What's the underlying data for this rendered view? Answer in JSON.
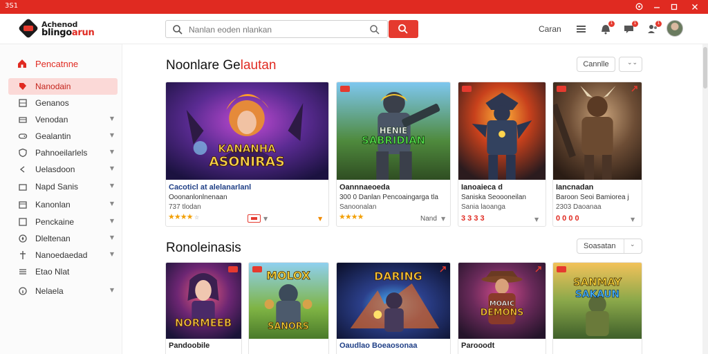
{
  "window": {
    "app_mark": "3S1",
    "controls": [
      "settings",
      "minimize",
      "maximize",
      "close"
    ]
  },
  "header": {
    "logo_line1": "Achenod",
    "logo_line2_a": "blingo",
    "logo_line2_b": "arun",
    "search_placeholder": "Nanlan eoden nlankan",
    "right_label": "Caran",
    "icons": [
      "menu-icon",
      "bell-icon",
      "chat-icon",
      "friends-icon"
    ],
    "badge_count": "1"
  },
  "sidebar": {
    "home_label": "Pencatnne",
    "items": [
      {
        "label": "Nanodain",
        "icon": "tag-icon",
        "has_chevron": false,
        "active": true
      },
      {
        "label": "Genanos",
        "icon": "grid-icon",
        "has_chevron": false
      },
      {
        "label": "Venodan",
        "icon": "tray-icon",
        "has_chevron": true
      },
      {
        "label": "Gealantin",
        "icon": "gamepad-icon",
        "has_chevron": true
      },
      {
        "label": "Pahnoeilarlels",
        "icon": "shield-icon",
        "has_chevron": true
      },
      {
        "label": "Uelasdoon",
        "icon": "chevron-left-icon",
        "has_chevron": true
      },
      {
        "label": "Napd Sanis",
        "icon": "store-icon",
        "has_chevron": true
      },
      {
        "label": "Kanonlan",
        "icon": "calendar-icon",
        "has_chevron": true
      },
      {
        "label": "Penckaine",
        "icon": "box-icon",
        "has_chevron": true
      },
      {
        "label": "Dleltenan",
        "icon": "compass-icon",
        "has_chevron": true
      },
      {
        "label": "Nanoedaedad",
        "icon": "sword-icon",
        "has_chevron": true
      },
      {
        "label": "Etao Nlat",
        "icon": "list-icon",
        "has_chevron": false
      },
      {
        "label": "Nelaela",
        "icon": "info-icon",
        "has_chevron": true
      }
    ]
  },
  "section1": {
    "title_a": "Noonlare Ge",
    "title_b": "lautan",
    "button_label": "Cannlle",
    "cards": [
      {
        "art_text_1": "KANANHA",
        "art_text_2": "ASONIRAS",
        "title": "Cacoticl at alelanarlanl",
        "line2": "Ooonanlonlnenaan",
        "line3": "737 tlodan",
        "rating": "★★★★",
        "rating_extra": "☆"
      },
      {
        "art_text_1": "HENIE",
        "art_text_2": "SABRIDIAN",
        "title": "Oannnaeoeda",
        "line2": "300 0 Danlan Pencoaingarga tla",
        "line3": "Sanoonalan",
        "rating": "★★★★",
        "meta": "Nand"
      },
      {
        "title": "Ianoaieca d",
        "line2": "Saniska Seoooneilan",
        "line3": "Sania laoanga",
        "price": "3 3 3 3"
      },
      {
        "title": "Iancnadan",
        "line2": "Baroon Seoi Bamiorea j",
        "line3": "2303 Daoanaa",
        "price": "0 0 0 0"
      }
    ]
  },
  "section2": {
    "title": "Ronoleinasis",
    "button_label": "Soasatan",
    "cards": [
      {
        "art_text": "NORMEEB",
        "title": "Pandoobile"
      },
      {
        "art_text_1": "MOLOX",
        "art_text_2": "SANORS",
        "title": ""
      },
      {
        "art_text": "DARING",
        "title": "Oaudlao Boeaosonaa"
      },
      {
        "art_text_1": "MOAIC",
        "art_text_2": "DEMONS",
        "title": "Parooodt"
      },
      {
        "art_text_1": "SANMAY",
        "art_text_2": "SAKAUN",
        "title": ""
      }
    ]
  },
  "colors": {
    "accent": "#e02a21",
    "active_bg": "#fbd9d7",
    "star": "#f2a007",
    "link": "#1f3f86"
  }
}
